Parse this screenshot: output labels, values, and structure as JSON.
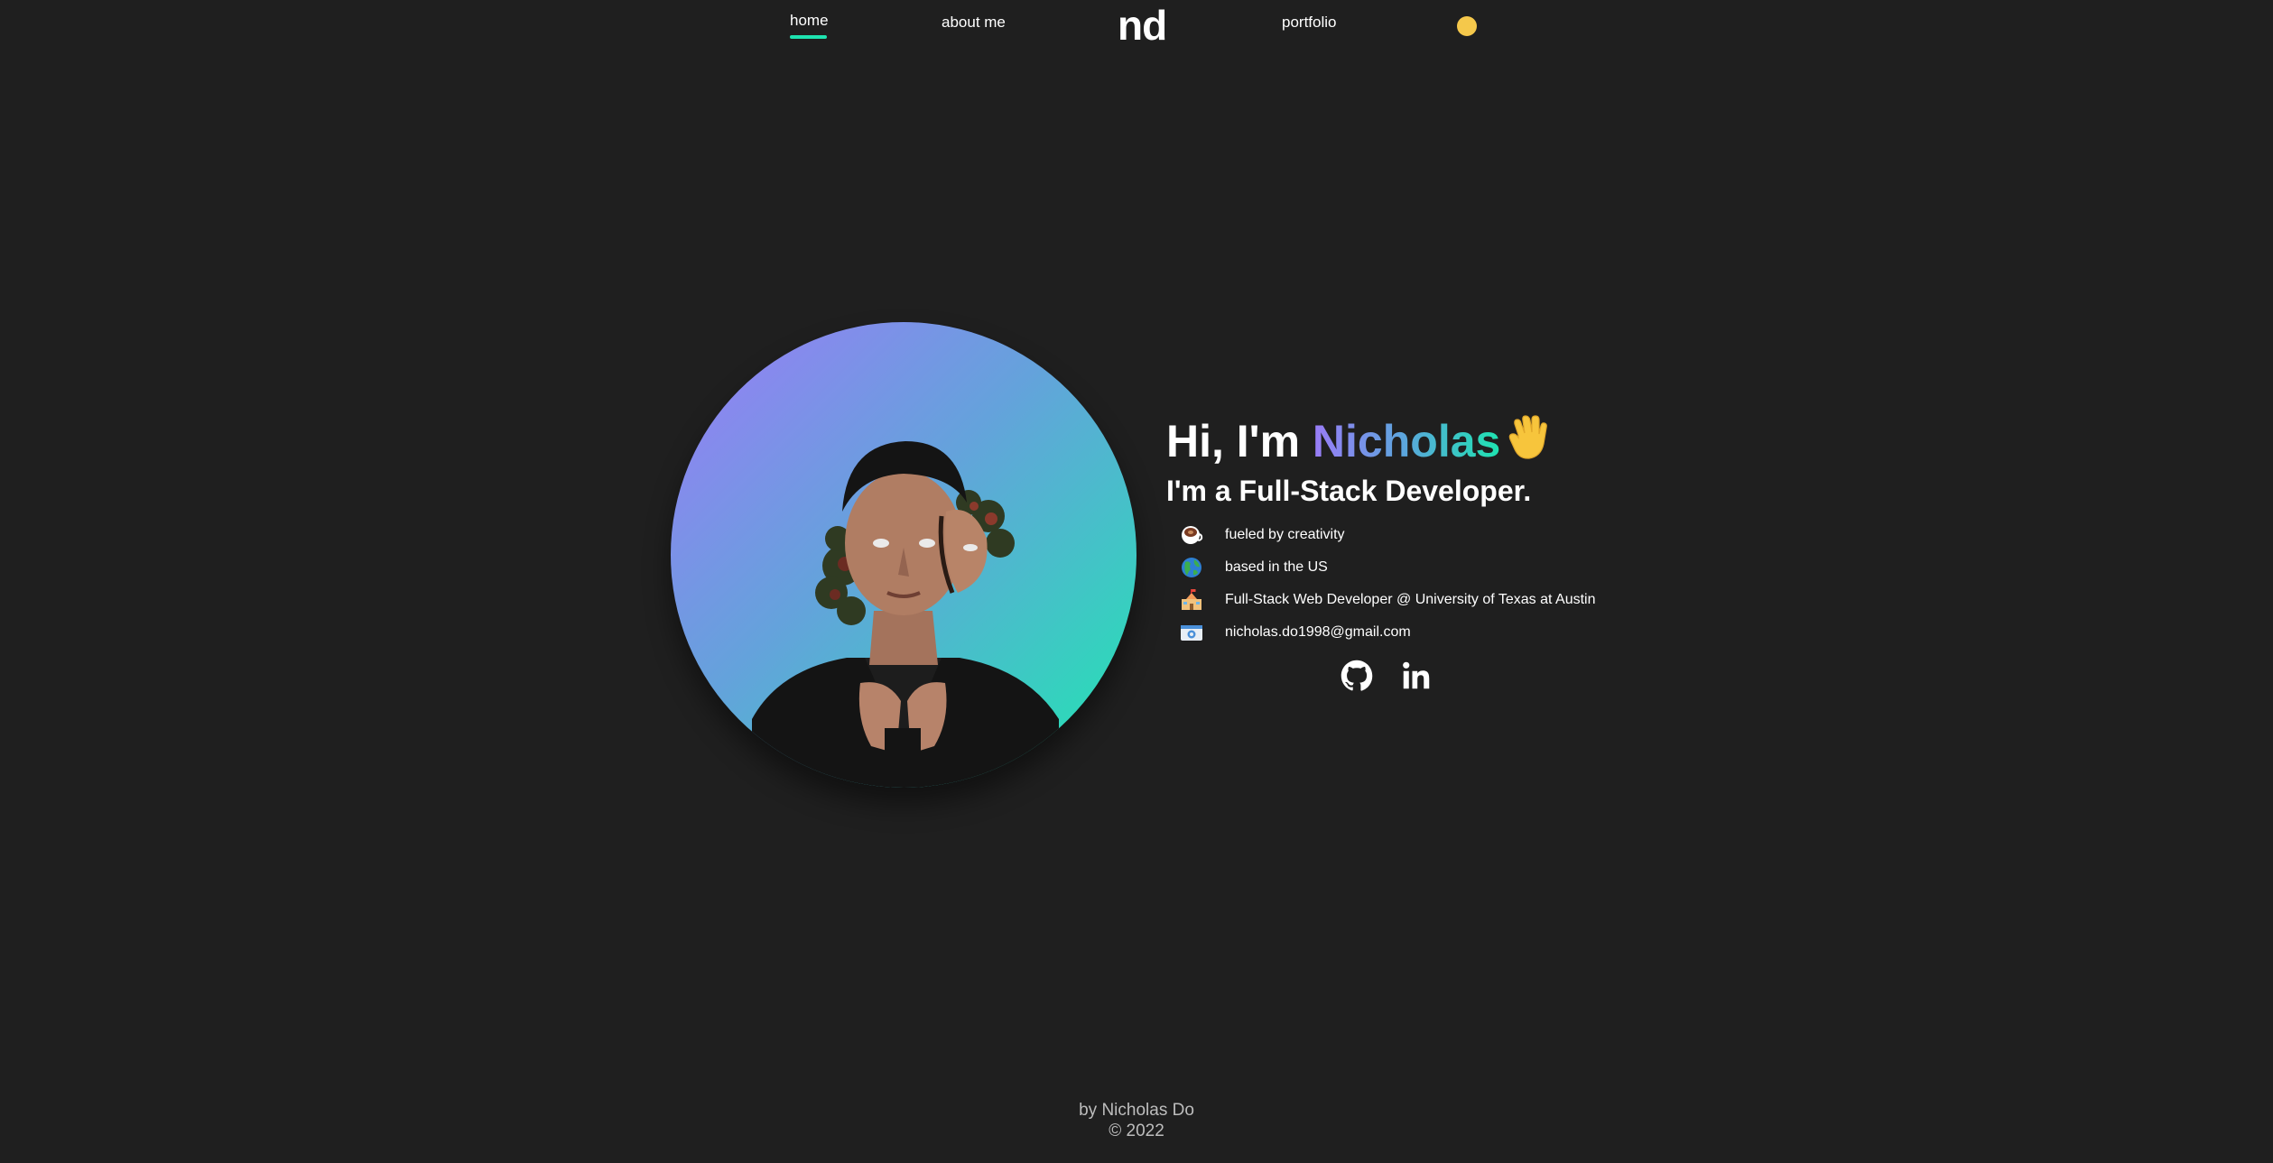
{
  "nav": {
    "home": "home",
    "about": "about me",
    "logo": "nd",
    "portfolio": "portfolio",
    "active": "home",
    "theme_toggle_color": "#f5c84b",
    "active_underline_color": "#1ee3b0"
  },
  "hero": {
    "greeting_prefix": "Hi, I'm ",
    "name": "Nicholas",
    "wave_icon": "waving-hand-icon",
    "role": "I'm a Full-Stack Developer.",
    "gradient_colors": [
      "#9a7cf7",
      "#5aa7dc",
      "#1ee3b0"
    ]
  },
  "info": [
    {
      "icon": "coffee-icon",
      "text": "fueled by creativity"
    },
    {
      "icon": "globe-icon",
      "text": "based in the US"
    },
    {
      "icon": "school-icon",
      "text": "Full-Stack Web Developer @ University of Texas at Austin"
    },
    {
      "icon": "email-icon",
      "text": "nicholas.do1998@gmail.com"
    }
  ],
  "social": [
    {
      "icon": "github-icon"
    },
    {
      "icon": "linkedin-icon"
    }
  ],
  "footer": {
    "line1": "by Nicholas Do",
    "line2": "© 2022"
  }
}
